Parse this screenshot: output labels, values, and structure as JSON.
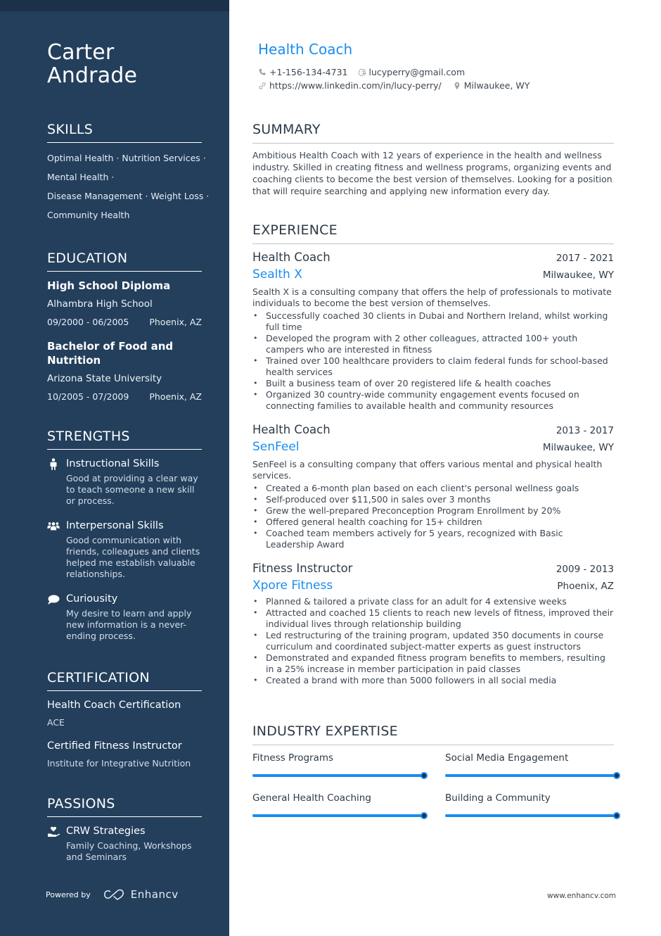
{
  "profile": {
    "first_name": "Carter",
    "last_name": "Andrade",
    "title": "Health Coach",
    "phone": "+1-156-134-4731",
    "email": "lucyperry@gmail.com",
    "linkedin": "https://www.linkedin.com/in/lucy-perry/",
    "location": "Milwaukee, WY"
  },
  "colors": {
    "sidebar": "#233f5c",
    "accent": "#1a8cf0",
    "text": "#3d4752"
  },
  "skills": {
    "title": "SKILLS",
    "lines": [
      "Optimal Health · Nutrition Services ·",
      "Mental Health ·",
      "Disease Management · Weight Loss ·",
      "Community Health"
    ]
  },
  "education": {
    "title": "EDUCATION",
    "items": [
      {
        "degree": "High School Diploma",
        "school": "Alhambra High School",
        "dates": "09/2000 - 06/2005",
        "location": "Phoenix, AZ"
      },
      {
        "degree": "Bachelor of Food and Nutrition",
        "school": "Arizona State University",
        "dates": "10/2005 - 07/2009",
        "location": "Phoenix, AZ"
      }
    ]
  },
  "strengths": {
    "title": "STRENGTHS",
    "items": [
      {
        "icon": "person-icon",
        "title": "Instructional Skills",
        "desc": "Good at providing a clear way to teach someone a new skill or process."
      },
      {
        "icon": "users-icon",
        "title": "Interpersonal Skills",
        "desc": "Good communication with friends, colleagues and clients helped me establish valuable relationships."
      },
      {
        "icon": "comment-icon",
        "title": "Curiousity",
        "desc": "My desire to learn and apply new information is a never-ending process."
      }
    ]
  },
  "certification": {
    "title": "CERTIFICATION",
    "items": [
      {
        "title": "Health Coach Certification",
        "issuer": "ACE"
      },
      {
        "title": "Certified Fitness Instructor",
        "issuer": "Institute for Integrative Nutrition"
      }
    ]
  },
  "passions": {
    "title": "PASSIONS",
    "items": [
      {
        "icon": "hand-heart-icon",
        "title": "CRW Strategies",
        "desc": "Family Coaching, Workshops and Seminars"
      }
    ]
  },
  "footer": {
    "powered_by": "Powered by",
    "brand": "Enhancv",
    "website": "www.enhancv.com"
  },
  "summary": {
    "title": "SUMMARY",
    "text": "Ambitious Health Coach with 12 years of experience in the health and wellness industry. Skilled in creating fitness and wellness programs, organizing events and coaching clients to become the best version of themselves. Looking for a position that will require searching and applying new information every day."
  },
  "experience": {
    "title": "EXPERIENCE",
    "items": [
      {
        "role": "Health Coach",
        "dates": "2017 - 2021",
        "company": "Sealth X",
        "location": "Milwaukee, WY",
        "description": "Sealth X is a consulting company that offers the help of professionals to motivate individuals to become the best version of themselves.",
        "bullets": [
          "Successfully coached 30 clients in Dubai and Northern Ireland, whilst working full time",
          "Developed the program with 2 other colleagues, attracted 100+ youth campers who are interested in fitness",
          "Trained over 100 healthcare providers to claim federal funds for school-based health services",
          "Built a business team of over 20 registered life & health coaches",
          "Organized 30 country-wide community engagement events focused on connecting families to available health and community resources"
        ]
      },
      {
        "role": "Health Coach",
        "dates": "2013 - 2017",
        "company": "SenFeel",
        "location": "Milwaukee, WY",
        "description": "SenFeel is a consulting company that offers various mental and physical health services.",
        "bullets": [
          "Created a 6-month plan based on each client's personal wellness goals",
          "Self-produced over $11,500 in sales over 3 months",
          "Grew the well-prepared Preconception Program Enrollment by 20%",
          "Offered general health coaching for 15+ children",
          "Coached team members actively for 5 years, recognized with Basic Leadership Award"
        ]
      },
      {
        "role": "Fitness Instructor",
        "dates": "2009 - 2013",
        "company": "Xpore Fitness",
        "location": "Phoenix, AZ",
        "description": "",
        "bullets": [
          "Planned & tailored a private class for an adult for 4 extensive weeks",
          "Attracted and coached 15 clients to reach new levels of fitness, improved their individual lives through relationship building",
          "Led restructuring of the training program, updated 350 documents in course curriculum and coordinated subject-matter experts as guest instructors",
          "Demonstrated and expanded fitness program benefits to members, resulting in a 25% increase in member participation in paid classes",
          "Created a brand with more than 5000 followers in all social media"
        ]
      }
    ]
  },
  "industry_expertise": {
    "title": "INDUSTRY EXPERTISE",
    "items": [
      {
        "label": "Fitness Programs",
        "level": 1.0
      },
      {
        "label": "Social Media Engagement",
        "level": 1.0
      },
      {
        "label": "General Health Coaching",
        "level": 1.0
      },
      {
        "label": "Building a Community",
        "level": 1.0
      }
    ]
  }
}
